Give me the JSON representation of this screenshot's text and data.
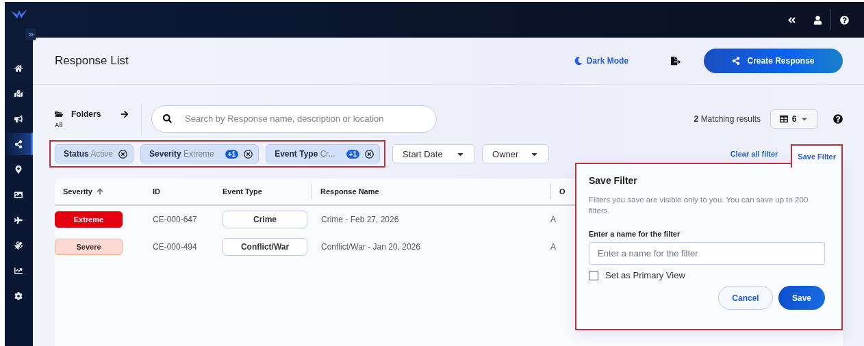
{
  "sidebar": {
    "items": [
      {
        "selected": false
      },
      {
        "selected": false
      },
      {
        "selected": false
      },
      {
        "selected": true
      },
      {
        "selected": false
      },
      {
        "selected": false
      },
      {
        "selected": false
      },
      {
        "selected": false
      },
      {
        "selected": false
      },
      {
        "selected": false
      }
    ]
  },
  "header": {
    "title": "Response List",
    "dark_mode": "Dark Mode",
    "create_button": "Create Response"
  },
  "toolbar": {
    "folders": {
      "label": "Folders",
      "current": "All"
    },
    "search": {
      "placeholder": "Search by Response name, description or location"
    },
    "results": {
      "count": "2",
      "label": "Matching results"
    },
    "columns_button": "6"
  },
  "filters": {
    "chips": [
      {
        "name": "Status",
        "value": "Active"
      },
      {
        "name": "Severity",
        "value": "Extreme",
        "badge": "+1"
      },
      {
        "name": "Event Type",
        "value": "Cr...",
        "badge": "+1"
      }
    ],
    "dropdowns": [
      "Start Date",
      "Owner"
    ],
    "clear": "Clear all filter",
    "save": "Save Filter"
  },
  "table": {
    "columns": [
      {
        "label": "Severity",
        "sorted": true
      },
      {
        "label": "ID",
        "sorted": false
      },
      {
        "label": "Event Type",
        "sorted": false
      },
      {
        "label": "Response Name",
        "sorted": false
      },
      {
        "label": "O",
        "sorted": false
      }
    ],
    "rows": [
      {
        "severity": "Extreme",
        "kind": "extreme",
        "id": "CE-000-647",
        "event_type": "Crime",
        "response_name": "Crime - Feb 27, 2026",
        "column_5": "A"
      },
      {
        "severity": "Severe",
        "kind": "severe",
        "id": "CE-000-494",
        "event_type": "Conflict/War",
        "response_name": "Conflict/War - Jan 20, 2026",
        "column_5": "A"
      }
    ]
  },
  "save_filter_dialog": {
    "title": "Save Filter",
    "description": "Filters you save are visible only to you. You can save up to 200 filters.",
    "field_label": "Enter a name for the filter",
    "placeholder": "Enter a name for the filter",
    "primary_view": {
      "label": "Set as Primary View",
      "checked": false
    },
    "buttons": [
      "Cancel",
      "Save"
    ]
  }
}
